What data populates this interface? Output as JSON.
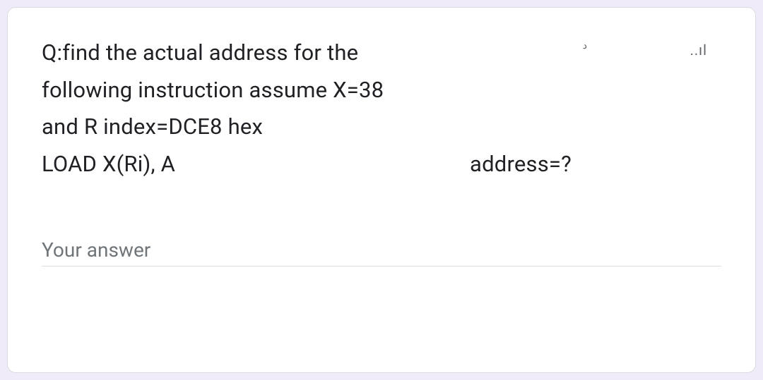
{
  "card": {
    "question": {
      "line1": "Q:find the actual address for the",
      "line2": "following instruction assume X=38",
      "line3": "and R index=DCE8  hex",
      "line4_left": "LOAD X(Ri), A",
      "line4_right": "address=?"
    },
    "marks": {
      "top_right": "..ıl",
      "small": "ﺩ"
    },
    "answer": {
      "placeholder": "Your answer",
      "value": ""
    }
  }
}
